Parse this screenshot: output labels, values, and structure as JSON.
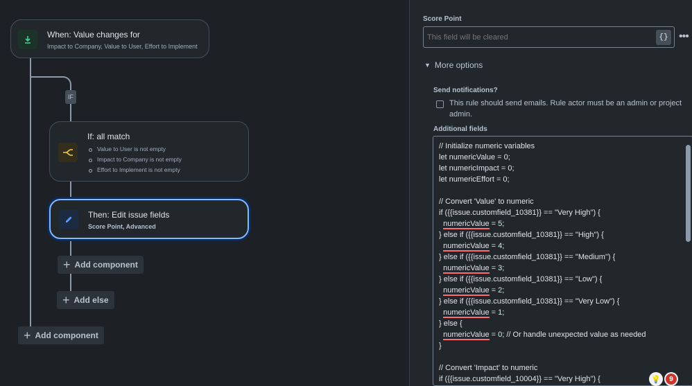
{
  "flow": {
    "trigger": {
      "title": "When: Value changes for",
      "subtitle": "Impact to Company, Value to User, Effort to Implement"
    },
    "if_badge": "IF",
    "condition": {
      "title": "If: all match",
      "items": [
        "Value to User is not empty",
        "Impact to Company is not empty",
        "Effort to Implement is not empty"
      ]
    },
    "action": {
      "title": "Then: Edit issue fields",
      "subtitle": "Score Point, Advanced"
    },
    "add_component_inner": "Add component",
    "add_else": "Add else",
    "add_component_outer": "Add component"
  },
  "panel": {
    "field_label": "Score Point",
    "field_placeholder": "This field will be cleared",
    "brace_button": "{}",
    "more_options": "More options",
    "send_notifications_label": "Send notifications?",
    "send_notifications_text": "This rule should send emails. Rule actor must be an admin or project admin.",
    "additional_fields_label": "Additional fields",
    "code_lines": [
      "// Initialize numeric variables",
      "let numericValue = 0;",
      "let numericImpact = 0;",
      "let numericEffort = 0;",
      "",
      "// Convert 'Value' to numeric",
      "if ({{issue.customfield_10381}} == \"Very High\") {",
      "  numericValue = 5;",
      "} else if ({{issue.customfield_10381}} == \"High\") {",
      "  numericValue = 4;",
      "} else if ({{issue.customfield_10381}} == \"Medium\") {",
      "  numericValue = 3;",
      "} else if ({{issue.customfield_10381}} == \"Low\") {",
      "  numericValue = 2;",
      "} else if ({{issue.customfield_10381}} == \"Very Low\") {",
      "  numericValue = 1;",
      "} else {",
      "  numericValue = 0; // Or handle unexpected value as needed",
      "}",
      "",
      "// Convert 'Impact' to numeric",
      "if ({{issue.customfield_10004}} == \"Very High\") {"
    ],
    "helper_badge_count": "9"
  }
}
